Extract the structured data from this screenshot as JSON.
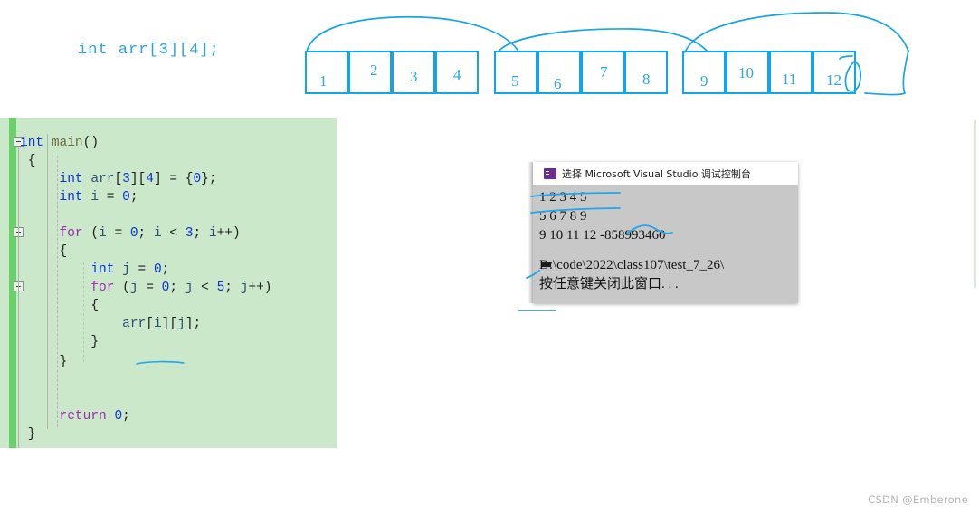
{
  "diagram": {
    "declaration": "int arr[3][4];",
    "accent_color": "#14a5e8",
    "rows": [
      {
        "cells": [
          "1",
          "2",
          "3",
          "4"
        ]
      },
      {
        "cells": [
          "5",
          "6",
          "7",
          "8"
        ]
      },
      {
        "cells": [
          "9",
          "10",
          "11",
          "12"
        ]
      }
    ],
    "extra_scribble": "0",
    "arc_count": 3
  },
  "code_editor": {
    "background_color": "#cbe8cb",
    "change_marker_color": "#68d168",
    "lines": [
      "int main()",
      "{",
      "    int arr[3][4] = {0};",
      "    int i = 0;",
      "",
      "    for (i = 0; i < 3; i++)",
      "    {",
      "        int j = 0;",
      "        for (j = 0; j < 5; j++)",
      "        {",
      "            arr[i][j];",
      "        }",
      "    }",
      "",
      "",
      "    return 0;",
      "}"
    ],
    "current_line_index": 12,
    "annotation_underline": "i < 3"
  },
  "console": {
    "title": "选择 Microsoft Visual Studio 调试控制台",
    "icon": "console-app-icon",
    "output_lines": [
      "1 2 3 4 5",
      "5 6 7 8 9",
      "9 10 11 12 -858993460",
      "",
      "D:\\code\\2022\\class107\\test_7_26\\",
      "按任意键关闭此窗口. . ."
    ]
  },
  "watermark": {
    "text": "CSDN @Emberone"
  }
}
